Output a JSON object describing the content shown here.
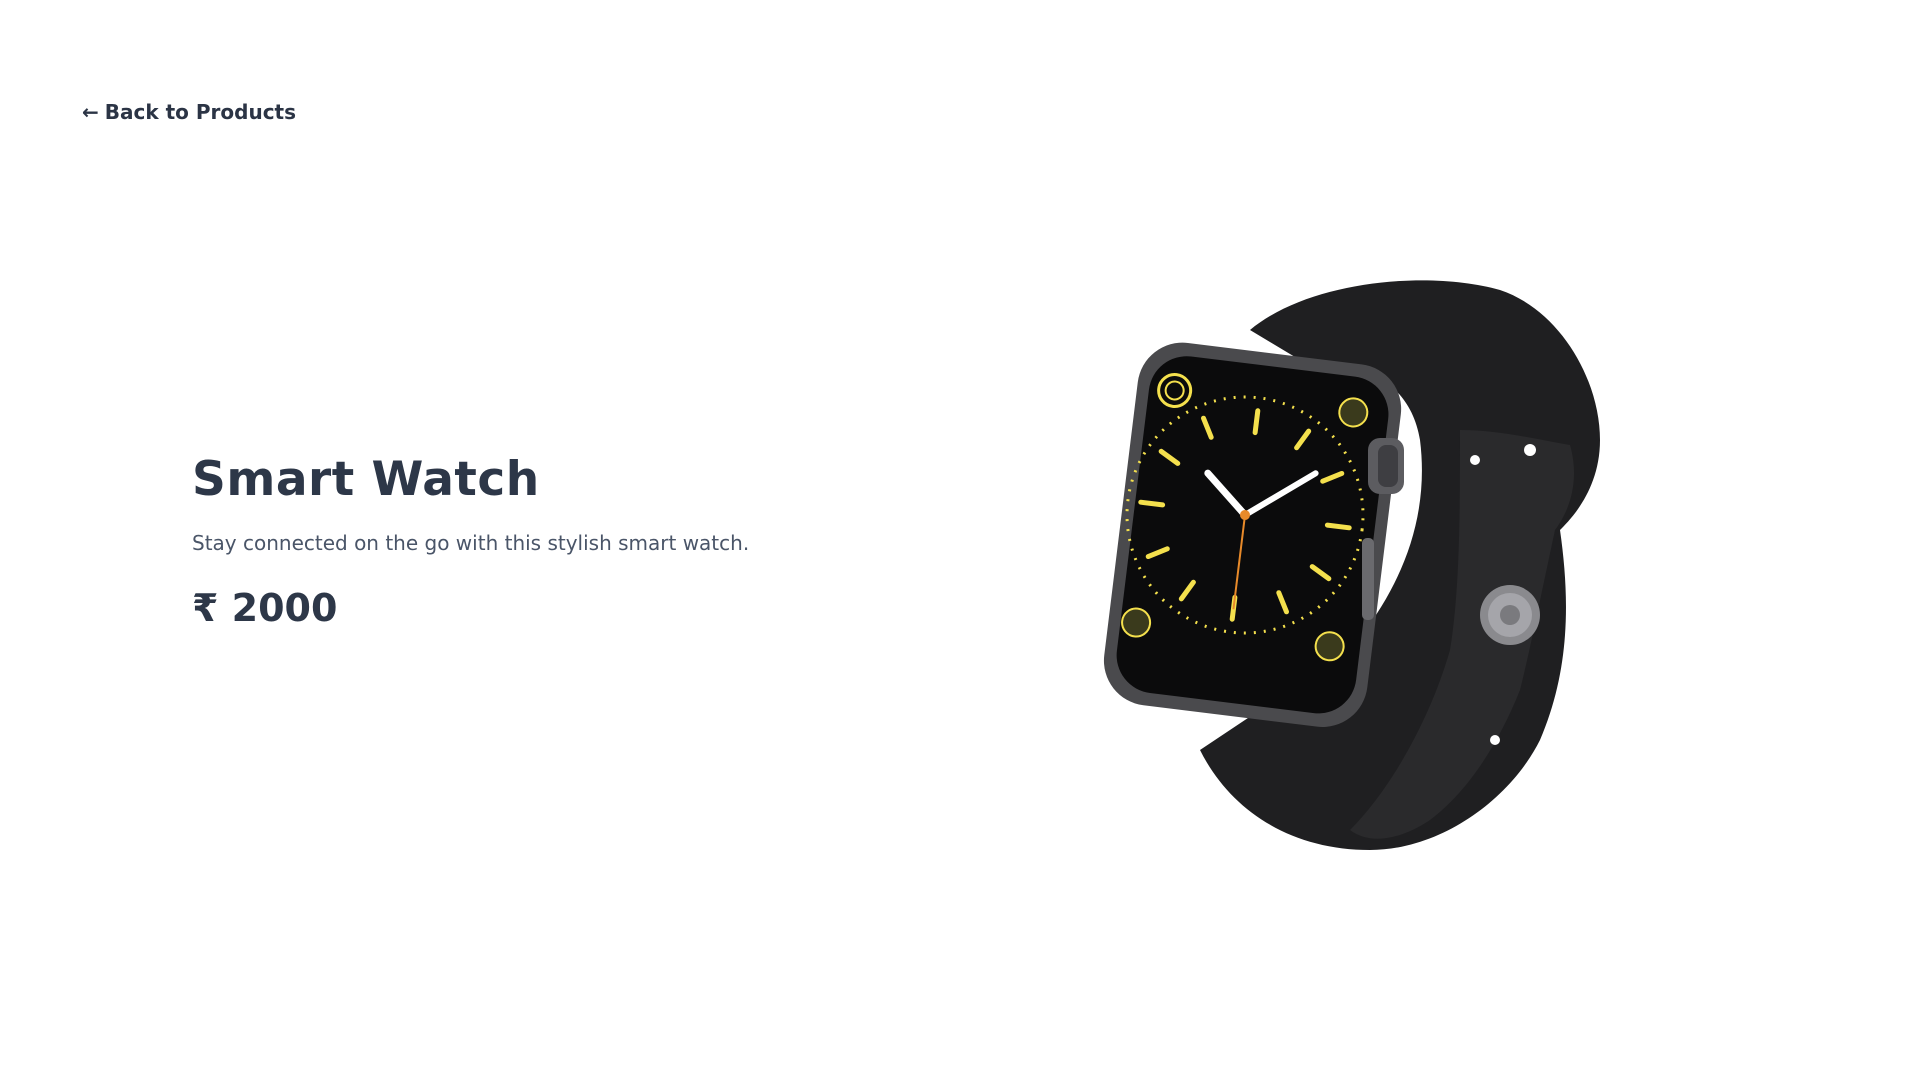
{
  "nav": {
    "back_arrow": "←",
    "back_label": "Back to Products"
  },
  "product": {
    "name": "Smart Watch",
    "description": "Stay connected on the go with this stylish smart watch.",
    "price": "₹ 2000",
    "image_icon": "smart-watch-image"
  },
  "colors": {
    "text_dark": "#2d3748",
    "text_muted": "#4a5568",
    "watch_band": "#1f1f21",
    "watch_accent": "#f4e04d"
  }
}
